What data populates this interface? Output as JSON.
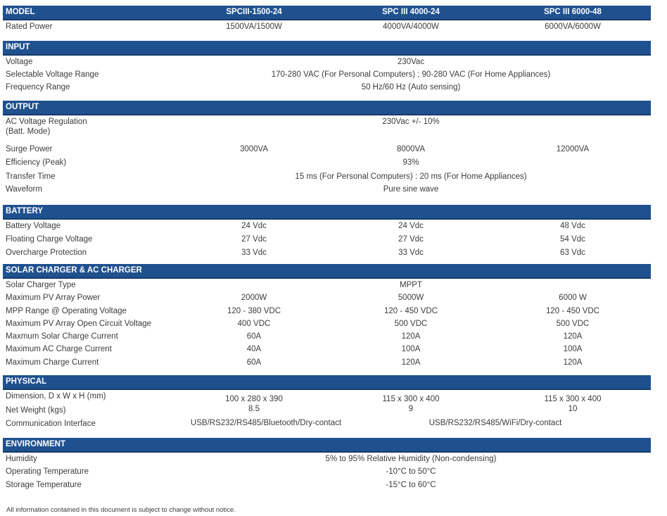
{
  "model": {
    "title": "MODEL",
    "models": [
      "SPCIII-1500-24",
      "SPC III 4000-24",
      "SPC III 6000-48"
    ],
    "rated_power_label": "Rated Power",
    "rated_power": [
      "1500VA/1500W",
      "4000VA/4000W",
      "6000VA/6000W"
    ]
  },
  "input": {
    "title": "INPUT",
    "voltage_label": "Voltage",
    "voltage": "230Vac",
    "range_label": "Selectable Voltage Range",
    "range": "170-280 VAC (For Personal Computers) ; 90-280 VAC (For Home Appliances)",
    "freq_label": "Frequency Range",
    "freq": "50 Hz/60 Hz (Auto sensing)"
  },
  "output": {
    "title": "OUTPUT",
    "reg_label": "AC Voltage Regulation\n(Batt. Mode)",
    "reg": "230Vac +/- 10%",
    "surge_label": "Surge Power",
    "surge": [
      "3000VA",
      "8000VA",
      "12000VA"
    ],
    "eff_label": "Efficiency (Peak)",
    "eff": "93%",
    "transfer_label": "Transfer Time",
    "transfer": "15 ms (For Personal Computers) : 20 ms (For Home Appliances)",
    "wave_label": "Waveform",
    "wave": "Pure sine wave"
  },
  "battery": {
    "title": "BATTERY",
    "rows": [
      {
        "label": "Battery Voltage",
        "values": [
          "24 Vdc",
          "24 Vdc",
          "48 Vdc"
        ]
      },
      {
        "label": "Floating Charge Voltage",
        "values": [
          "27 Vdc",
          "27 Vdc",
          "54 Vdc"
        ]
      },
      {
        "label": "Overcharge Protection",
        "values": [
          "33 Vdc",
          "33 Vdc",
          "63 Vdc"
        ]
      }
    ]
  },
  "solar": {
    "title": "SOLAR CHARGER & AC CHARGER",
    "type_label": "Solar Charger Type",
    "type": "MPPT",
    "rows": [
      {
        "label": "Maximum PV Array Power",
        "values": [
          "2000W",
          "5000W",
          "6000 W"
        ]
      },
      {
        "label": "MPP Range @ Operating Voltage",
        "values": [
          "120 - 380 VDC",
          "120 - 450 VDC",
          "120 - 450 VDC"
        ]
      },
      {
        "label": "Maximum PV Array Open Circuit Voltage",
        "values": [
          "400 VDC",
          "500 VDC",
          "500 VDC"
        ]
      },
      {
        "label": "Maxmum Solar Charge Current",
        "values": [
          "60A",
          "120A",
          "120A"
        ]
      },
      {
        "label": "Maximum AC Charge Current",
        "values": [
          "40A",
          "100A",
          "100A"
        ]
      },
      {
        "label": "Maximum Charge Current",
        "values": [
          "60A",
          "120A",
          "120A"
        ]
      }
    ]
  },
  "physical": {
    "title": "PHYSICAL",
    "dim_label": "Dimension, D x W x H (mm)",
    "dim": [
      "100 x 280 x 390",
      "115 x 300 x 400",
      "115 x 300 x 400"
    ],
    "weight_label": "Net Weight (kgs)",
    "weight": [
      "8.5",
      "9",
      "10"
    ],
    "comm_label": "Communication Interface",
    "comm": [
      "USB/RS232/RS485/Bluetooth/Dry-contact",
      "USB/RS232/RS485/WiFi/Dry-contact"
    ]
  },
  "environment": {
    "title": "ENVIRONMENT",
    "rows": [
      {
        "label": "Humidity",
        "value": "5% to 95% Relative Humidity (Non-condensing)"
      },
      {
        "label": "Operating Temperature",
        "value": "-10°C to 50°C"
      },
      {
        "label": "Storage Temperature",
        "value": "-15°C to 60°C"
      }
    ]
  },
  "footnote": "All information contained in this document is subject to change without notice.",
  "colors": {
    "header_bg": "#20518f",
    "header_text": "#ffffff",
    "body_text": "#3c3c3c"
  }
}
